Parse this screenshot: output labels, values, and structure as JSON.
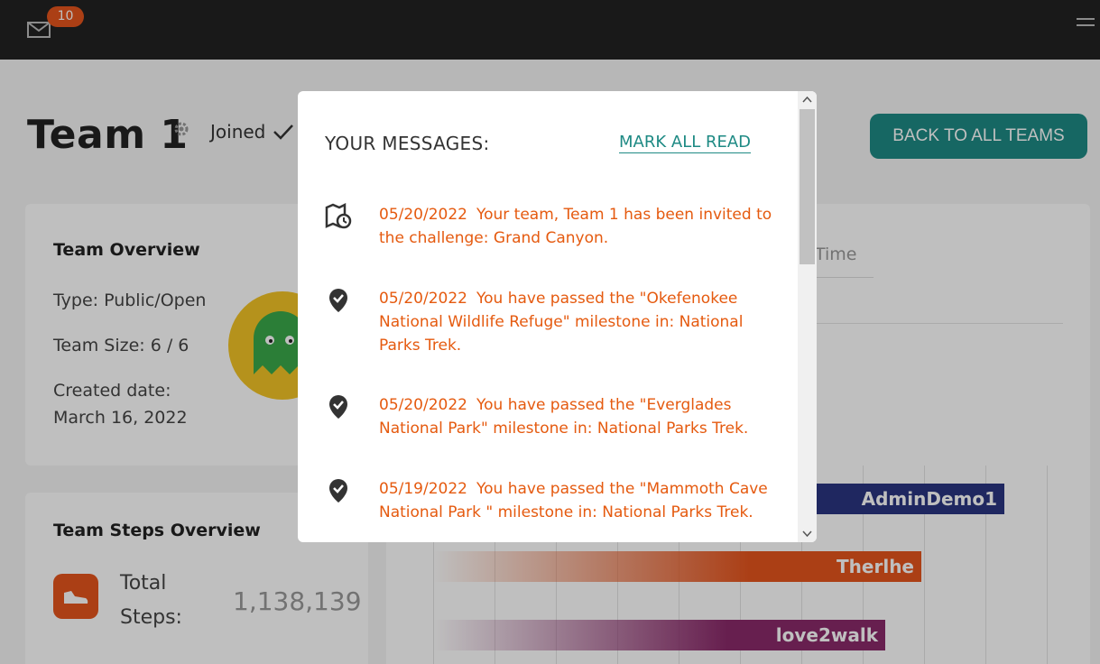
{
  "header": {
    "unread_count": "10"
  },
  "team": {
    "title": "Team 1",
    "joined_label": "Joined",
    "back_button": "BACK TO ALL TEAMS"
  },
  "overview": {
    "heading": "Team Overview",
    "type": "Type: Public/Open",
    "size": "Team Size: 6 / 6",
    "created_label": "Created date:",
    "created_value": "March 16, 2022"
  },
  "steps_overview": {
    "heading": "Team Steps Overview",
    "label": "Total Steps:",
    "value": "1,138,139"
  },
  "tabs": {
    "time": "Time"
  },
  "leaderboard": {
    "bars": [
      {
        "name": "AdminDemo1",
        "color": "#2a3580"
      },
      {
        "name": "Therlhe",
        "color": "#e5541d"
      },
      {
        "name": "love2walk",
        "color": "#8a2a6a"
      }
    ]
  },
  "modal": {
    "title": "YOUR MESSAGES:",
    "mark_all_read": "MARK ALL READ",
    "messages": [
      {
        "icon": "map-clock-icon",
        "date": "05/20/2022",
        "text": "Your team, Team 1 has been invited to the challenge: Grand Canyon."
      },
      {
        "icon": "location-check-icon",
        "date": "05/20/2022",
        "text": "You have passed the \"Okefenokee National Wildlife Refuge\" milestone in: National Parks Trek."
      },
      {
        "icon": "location-check-icon",
        "date": "05/20/2022",
        "text": "You have passed the \"Everglades National Park\" milestone in: National Parks Trek."
      },
      {
        "icon": "location-check-icon",
        "date": "05/19/2022",
        "text": "You have passed the \"Mammoth Cave National Park \" milestone in: National Parks Trek."
      }
    ]
  },
  "colors": {
    "accent": "#1e8a84",
    "message": "#e55a0f",
    "topbar": "#222222",
    "badge": "#e5541d"
  }
}
